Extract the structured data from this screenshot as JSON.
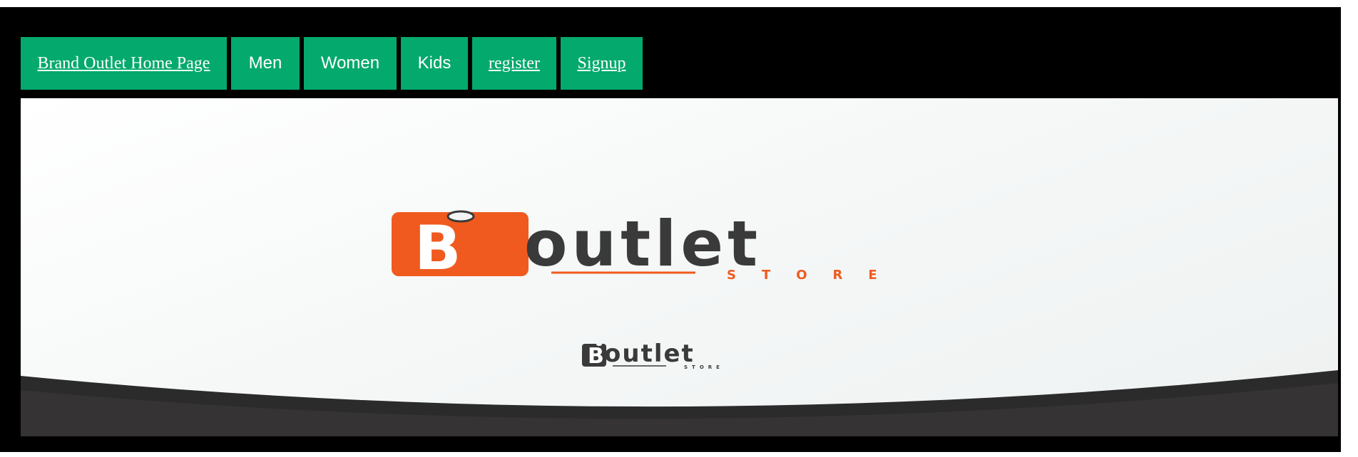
{
  "nav": {
    "home_label": "Brand Outlet Home Page",
    "men_label": "Men",
    "women_label": "Women",
    "kids_label": "Kids",
    "register_label": "register",
    "signup_label": "Signup"
  },
  "hero": {
    "logo_main_text": "outlet",
    "logo_badge_letter": "B",
    "logo_sub_text": "STORE"
  },
  "colors": {
    "nav_bg": "#04a96d",
    "logo_orange": "#f05a1e",
    "logo_dark": "#3a3a3a",
    "page_bg": "#000000"
  }
}
